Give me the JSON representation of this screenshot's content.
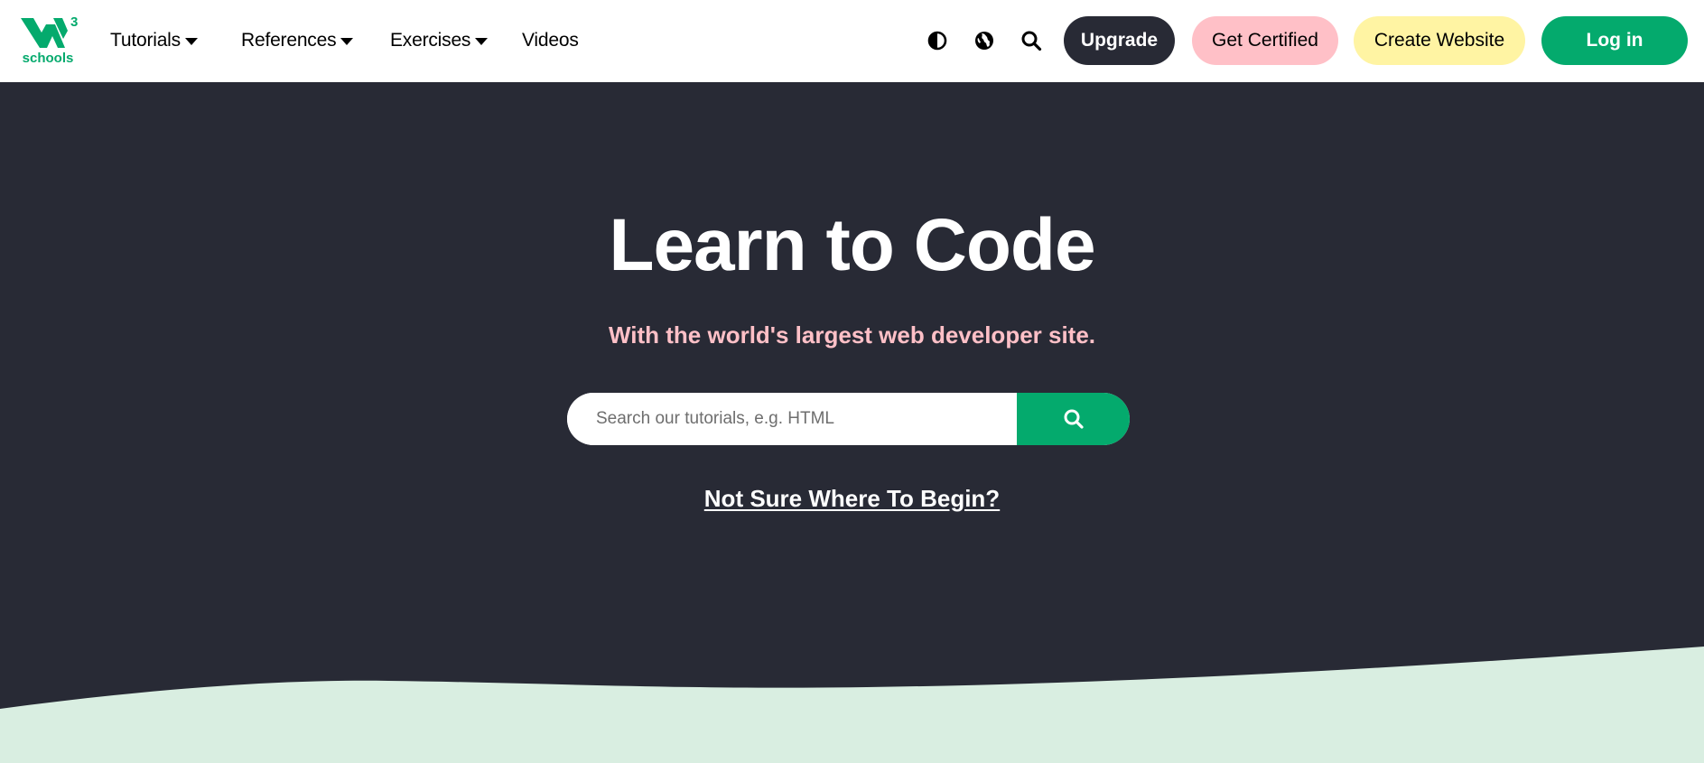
{
  "brand": {
    "logo_mark": "W",
    "logo_superscript": "3",
    "logo_text": "schools",
    "colors": {
      "green": "#04aa6d",
      "dark": "#282a35",
      "pink": "#ffc0c7",
      "yellow": "#fff4a3",
      "mint": "#d9eee1"
    }
  },
  "nav": {
    "items": [
      {
        "label": "Tutorials",
        "has_dropdown": true
      },
      {
        "label": "References",
        "has_dropdown": true
      },
      {
        "label": "Exercises",
        "has_dropdown": true
      },
      {
        "label": "Videos",
        "has_dropdown": false
      }
    ]
  },
  "toolbar": {
    "icons": [
      "contrast-icon",
      "globe-icon",
      "search-icon"
    ],
    "upgrade_label": "Upgrade",
    "certified_label": "Get Certified",
    "website_label": "Create Website",
    "login_label": "Log in"
  },
  "hero": {
    "title": "Learn to Code",
    "subtitle": "With the world's largest web developer site.",
    "search": {
      "placeholder": "Search our tutorials, e.g. HTML",
      "value": "",
      "button_icon": "search-icon"
    },
    "begin_link": "Not Sure Where To Begin?"
  }
}
